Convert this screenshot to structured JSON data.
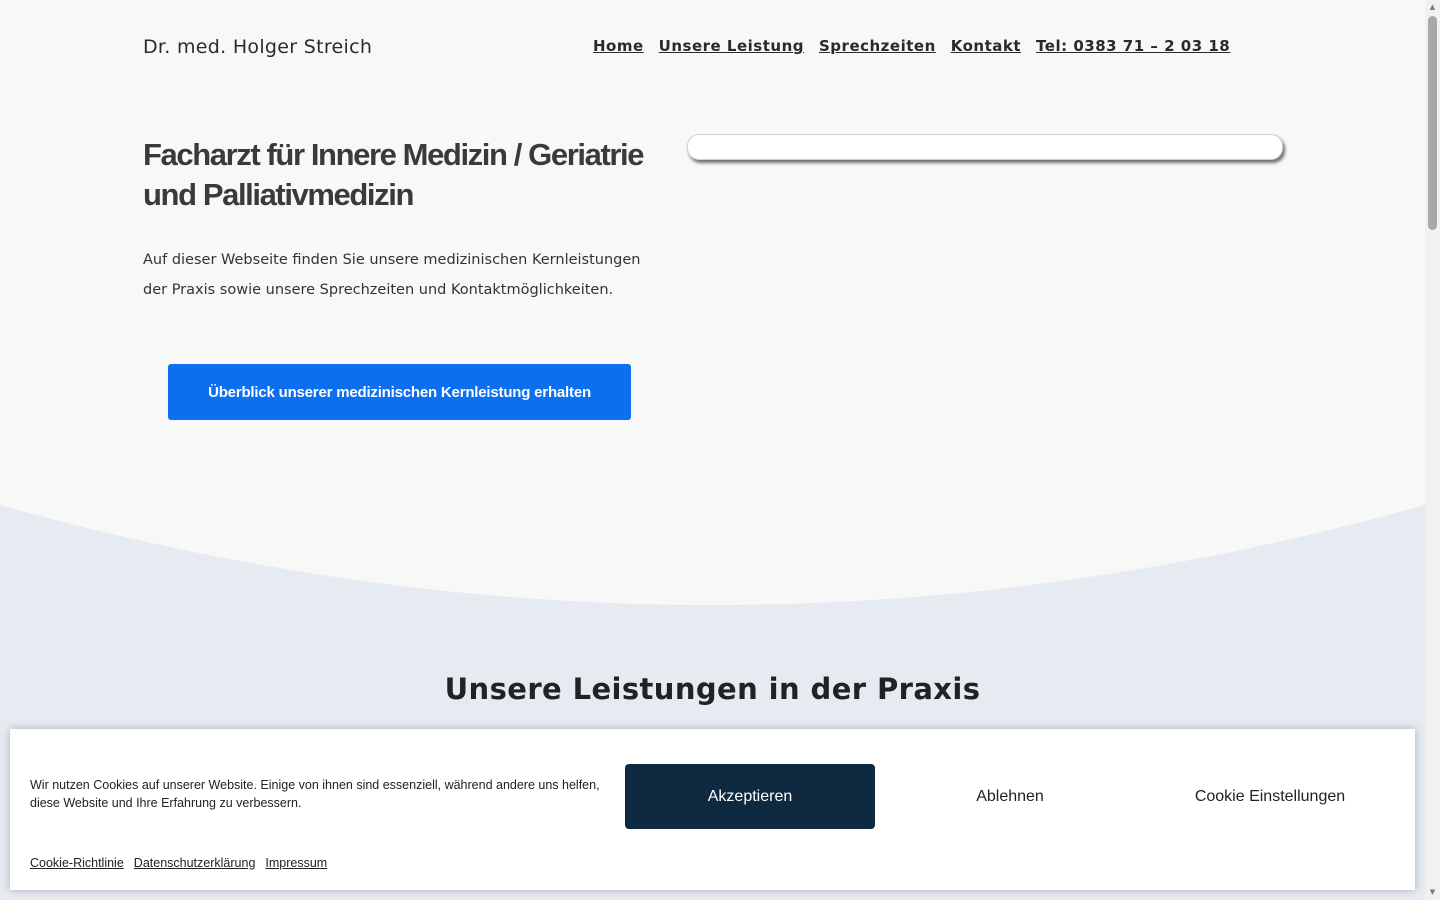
{
  "header": {
    "logo": "Dr. med. Holger Streich",
    "nav": [
      {
        "label": "Home"
      },
      {
        "label": "Unsere Leistung"
      },
      {
        "label": "Sprechzeiten"
      },
      {
        "label": "Kontakt"
      },
      {
        "label": "Tel: 0383 71 – 2 03 18"
      }
    ]
  },
  "hero": {
    "title": "Facharzt für Innere Medizin / Geriatrie und Palliativmedizin",
    "text": "Auf dieser Webseite finden Sie unsere medizinischen Kernleistungen der Praxis sowie unsere Sprechzeiten und Kontaktmöglichkeiten.",
    "cta_label": "Überblick unserer medizinischen Kernleistung erhalten"
  },
  "services": {
    "title": "Unsere Leistungen in der Praxis"
  },
  "cookie_banner": {
    "text": "Wir nutzen Cookies auf unserer Website. Einige von ihnen sind essenziell, während andere uns helfen, diese Website und Ihre Erfahrung zu verbessern.",
    "accept_label": "Akzeptieren",
    "deny_label": "Ablehnen",
    "settings_label": "Cookie Einstellungen",
    "links": [
      {
        "label": "Cookie-Richtlinie"
      },
      {
        "label": "Datenschutzerklärung"
      },
      {
        "label": "Impressum"
      }
    ]
  },
  "colors": {
    "page_bg": "#f8f8f8",
    "section_bg": "#e6ebf2",
    "cta_blue": "#0b6ff0",
    "accept_navy": "#0f2941"
  },
  "icons": {
    "scroll_up": "scroll-up-arrow",
    "scroll_down": "scroll-down-arrow"
  }
}
